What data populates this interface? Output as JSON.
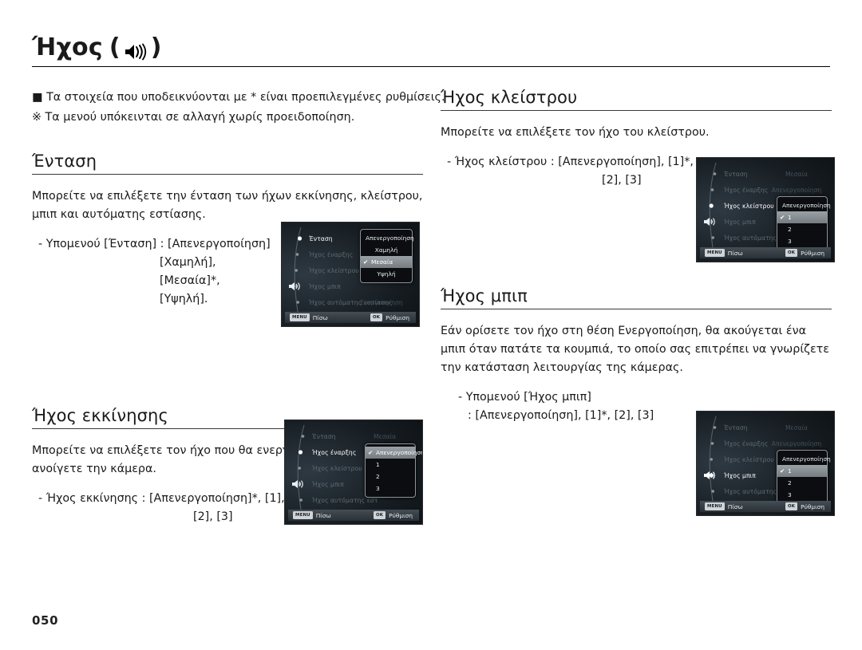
{
  "document": {
    "page_number": "050"
  },
  "title": {
    "text": "Ήχος",
    "open_paren": "(",
    "close_paren": ")",
    "icon": "speaker-icon"
  },
  "notes": {
    "bullet_marker": "■",
    "line1": "Τα στοιχεία που υποδεικνύονται με * είναι προεπιλεγμένες ρυθμίσεις.",
    "ref_marker": "※",
    "line2": "Τα μενού υπόκεινται σε αλλαγή χωρίς προειδοποίηση."
  },
  "sections": {
    "volume": {
      "heading": "Ένταση",
      "body": "Μπορείτε να επιλέξετε την ένταση των ήχων εκκίνησης, κλείστρου, μπιπ και αυτόματης εστίασης.",
      "bullet_line1": "-  Υπομενού [Ένταση] : [Απενεργοποίηση]",
      "bullet_line2": "[Χαμηλή],",
      "bullet_line3": "[Μεσαία]*,",
      "bullet_line4": "[Υψηλή]."
    },
    "startup_sound": {
      "heading": "Ήχος εκκίνησης",
      "body": "Μπορείτε να επιλέξετε τον ήχο που θα ενεργοποιείται όποτε ανοίγετε την κάμερα.",
      "bullet_line1": "- Ήχος εκκίνησης : [Απενεργοποίηση]*, [1],",
      "bullet_line2": "[2], [3]"
    },
    "shutter_sound": {
      "heading": "Ήχος κλείστρου",
      "body": "Μπορείτε να επιλέξετε τον ήχο του κλείστρου.",
      "bullet_line1": "- Ήχος κλείστρου : [Απενεργοποίηση], [1]*,",
      "bullet_line2": "[2], [3]"
    },
    "beep_sound": {
      "heading": "Ήχος μπιπ",
      "body": "Εάν ορίσετε τον ήχο στη θέση Ενεργοποίηση, θα ακούγεται ένα μπιπ όταν πατάτε τα κουμπιά, το οποίο σας επιτρέπει να γνωρίζετε την κατάσταση λειτουργίας της κάμερας.",
      "bullet_line1": "- Υπομενού [Ήχος μπιπ]",
      "bullet_line2": ": [Απενεργοποίηση], [1]*, [2], [3]"
    }
  },
  "lcd_common": {
    "menu_items": [
      "Ένταση",
      "Ήχος έναρξης",
      "Ήχος κλείστρου",
      "Ήχος μπιπ",
      "Ήχος αυτόματης εστίασης"
    ],
    "menu_items_truncated": [
      "Ένταση",
      "Ήχος έναρξης",
      "Ήχος κλείστρου",
      "Ήχος μπιπ",
      "Ήχος αυτόματης εστ"
    ],
    "back_key": "MENU",
    "back_label": "Πίσω",
    "ok_key": "OK",
    "ok_label": "Ρύθμιση",
    "checkmark": "✔"
  },
  "lcd_volume": {
    "active_index": 0,
    "row_values": [
      "",
      "",
      "",
      "",
      "Ενεργοποίηση"
    ],
    "dropdown": {
      "options": [
        "Απενεργοποίηση",
        "Χαμηλή",
        "Μεσαία",
        "Υψηλή"
      ],
      "selected": "Μεσαία"
    }
  },
  "lcd_startup": {
    "active_index": 1,
    "row_values": [
      "Μεσαία",
      "",
      "",
      "",
      ""
    ],
    "dropdown": {
      "options": [
        "Απενεργοποίηση",
        "1",
        "2",
        "3"
      ],
      "selected": "Απενεργοποίηση"
    }
  },
  "lcd_shutter": {
    "active_index": 2,
    "row_values": [
      "Μεσαία",
      "Απενεργοποίηση",
      "",
      "",
      ""
    ],
    "dropdown": {
      "options": [
        "Απενεργοποίηση",
        "1",
        "2",
        "3"
      ],
      "selected": "1"
    }
  },
  "lcd_beep": {
    "active_index": 3,
    "row_values": [
      "Μεσαία",
      "Απενεργοποίηση",
      "",
      "",
      ""
    ],
    "dropdown": {
      "options": [
        "Απενεργοποίηση",
        "1",
        "2",
        "3"
      ],
      "selected": "1"
    }
  }
}
